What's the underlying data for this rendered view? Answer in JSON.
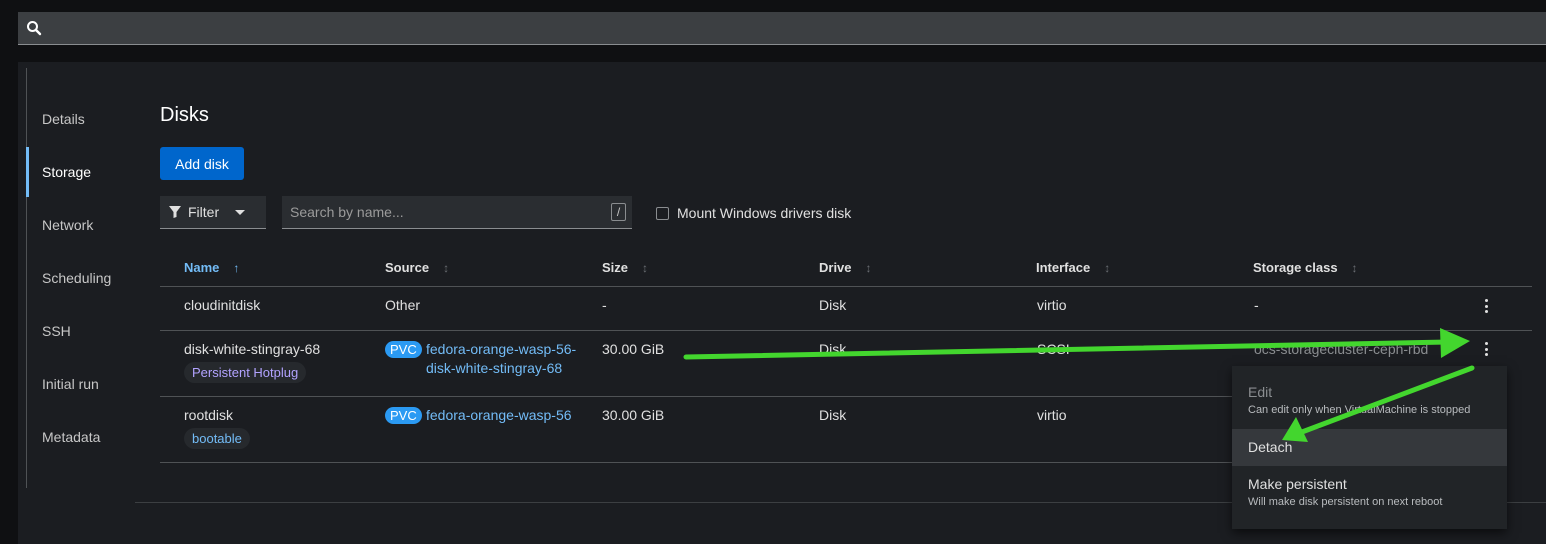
{
  "search": {
    "icon": "search-icon"
  },
  "sidebar": {
    "items": [
      {
        "label": "Details"
      },
      {
        "label": "Storage"
      },
      {
        "label": "Network"
      },
      {
        "label": "Scheduling"
      },
      {
        "label": "SSH"
      },
      {
        "label": "Initial run"
      },
      {
        "label": "Metadata"
      }
    ],
    "active": "Storage"
  },
  "page": {
    "title": "Disks",
    "add_label": "Add disk"
  },
  "toolbar": {
    "filter_label": "Filter",
    "search_placeholder": "Search by name...",
    "shortcut": "/",
    "mount_label": "Mount Windows drivers disk"
  },
  "table": {
    "columns": [
      "Name",
      "Source",
      "Size",
      "Drive",
      "Interface",
      "Storage class"
    ],
    "rows": [
      {
        "name": "cloudinitdisk",
        "source": "Other",
        "size": "-",
        "drive": "Disk",
        "interface": "virtio",
        "storage_class": "-"
      },
      {
        "name": "disk-white-stingray-68",
        "label": "Persistent Hotplug",
        "pvc": "PVC",
        "source_line1": "fedora-orange-wasp-56-",
        "source_line2": "disk-white-stingray-68",
        "size": "30.00 GiB",
        "drive": "Disk",
        "interface": "SCSI",
        "storage_class": "ocs-storagecluster-ceph-rbd"
      },
      {
        "name": "rootdisk",
        "label": "bootable",
        "pvc": "PVC",
        "source": "fedora-orange-wasp-56",
        "size": "30.00 GiB",
        "drive": "Disk",
        "interface": "virtio"
      }
    ]
  },
  "menu": {
    "edit": "Edit",
    "edit_desc": "Can edit only when VirtualMachine is stopped",
    "detach": "Detach",
    "persist": "Make persistent",
    "persist_desc": "Will make disk persistent on next reboot"
  },
  "colors": {
    "accent": "#73bcf7",
    "primary": "#0066cc",
    "annotation_arrow": "#43d62e"
  }
}
